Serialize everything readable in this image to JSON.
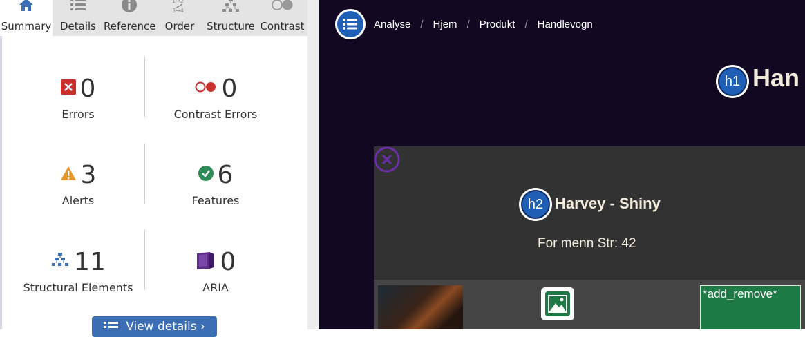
{
  "sidebar": {
    "tabs": [
      {
        "label": "Summary",
        "icon": "home-icon",
        "active": true
      },
      {
        "label": "Details",
        "icon": "list-icon",
        "active": false
      },
      {
        "label": "Reference",
        "icon": "info-icon",
        "active": false
      },
      {
        "label": "Order",
        "icon": "order-icon",
        "active": false
      },
      {
        "label": "Structure",
        "icon": "structure-icon",
        "active": false
      },
      {
        "label": "Contrast",
        "icon": "contrast-icon",
        "active": false
      }
    ],
    "stats": {
      "errors": {
        "value": "0",
        "label": "Errors",
        "icon": "error-icon"
      },
      "contrast_errors": {
        "value": "0",
        "label": "Contrast Errors",
        "icon": "contrast-error-icon"
      },
      "alerts": {
        "value": "3",
        "label": "Alerts",
        "icon": "alert-icon"
      },
      "features": {
        "value": "6",
        "label": "Features",
        "icon": "feature-icon"
      },
      "structural": {
        "value": "11",
        "label": "Structural Elements",
        "icon": "structure-icon"
      },
      "aria": {
        "value": "0",
        "label": "ARIA",
        "icon": "aria-icon"
      }
    },
    "view_details_label": "View details ›"
  },
  "page": {
    "breadcrumbs": [
      "Analyse",
      "Hjem",
      "Produkt",
      "Handlevogn"
    ],
    "breadcrumb_separator": "/",
    "h1_badge": "h1",
    "h1_text": "Han",
    "h2_badge": "h2",
    "product_title": "Harvey - Shiny",
    "product_subtitle": "For menn Str: 42",
    "add_remove_label": "*add_remove*"
  },
  "colors": {
    "page_bg": "#120822",
    "card_bg": "#333232",
    "accent_blue": "#1f5fb5",
    "error_red": "#c9302c",
    "alert_orange": "#e8952a",
    "feature_green": "#2e8b57",
    "aria_purple": "#5b2d86",
    "button_green": "#1e7a45"
  }
}
